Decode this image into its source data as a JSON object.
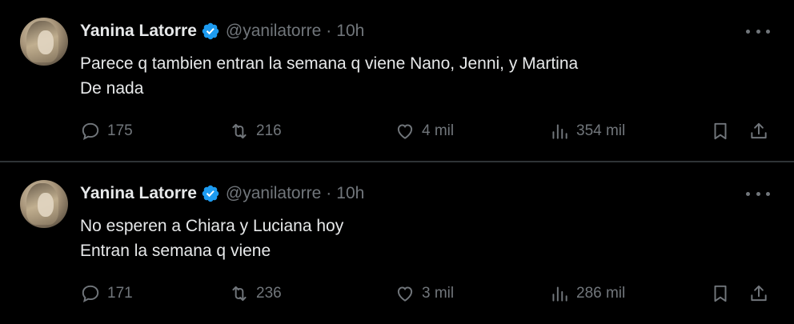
{
  "tweets": [
    {
      "author": "Yanina Latorre",
      "handle": "@yanilatorre",
      "separator": "·",
      "time": "10h",
      "lines": [
        "Parece q tambien entran la semana q viene Nano, Jenni, y Martina",
        "De nada"
      ],
      "replies": "175",
      "retweets": "216",
      "likes": "4 mil",
      "views": "354 mil"
    },
    {
      "author": "Yanina Latorre",
      "handle": "@yanilatorre",
      "separator": "·",
      "time": "10h",
      "lines": [
        "No esperen a Chiara y Luciana hoy",
        "Entran la semana q viene"
      ],
      "replies": "171",
      "retweets": "236",
      "likes": "3 mil",
      "views": "286 mil"
    }
  ],
  "colors": {
    "background": "#000000",
    "text": "#e7e9ea",
    "secondary": "#71767b",
    "divider": "#2f3336",
    "verified": "#1d9bf0"
  },
  "icons": [
    "verified-badge-icon",
    "more-options-icon",
    "reply-icon",
    "retweet-icon",
    "like-icon",
    "views-icon",
    "bookmark-icon",
    "share-icon"
  ]
}
